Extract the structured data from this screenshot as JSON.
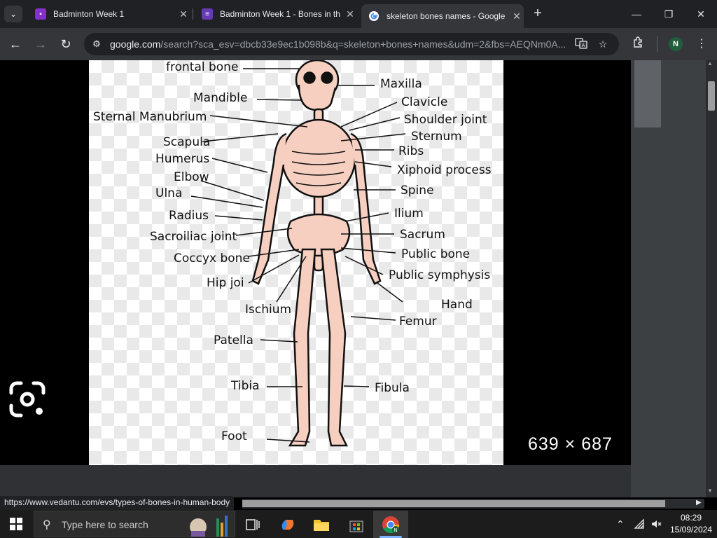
{
  "browser": {
    "tab_search_icon": "chevron-down-icon",
    "tabs": [
      {
        "title": "Badminton Week 1",
        "favicon": "classroom-assignment-icon",
        "favicon_color": "#8430ce"
      },
      {
        "title": "Badminton Week 1 - Bones in th",
        "favicon": "forms-icon",
        "favicon_color": "#673ab7"
      },
      {
        "title": "skeleton bones names - Google",
        "favicon": "google-icon",
        "favicon_color": "#ffffff"
      }
    ],
    "window_controls": {
      "minimize": "—",
      "maximize": "❐",
      "close": "✕"
    },
    "url_host": "google.com",
    "url_path": "/search?sca_esv=dbcb33e9ec1b098b&q=skeleton+bones+names&udm=2&fbs=AEQNm0A...",
    "profile_initial": "N",
    "status_url": "https://www.vedantu.com/evs/types-of-bones-in-human-body"
  },
  "viewer": {
    "image_dimensions": "639 × 687",
    "labels_left": [
      "frontal bone",
      "Mandible",
      "Sternal Manubrium",
      "Scapula",
      "Humerus",
      "Elbow",
      "Ulna",
      "Radius",
      "Sacroiliac joint",
      "Coccyx bone",
      "Hip joi",
      "Ischium",
      "Patella",
      "Tibia",
      "Foot"
    ],
    "labels_right": [
      "Maxilla",
      "Clavicle",
      "Shoulder joint",
      "Sternum",
      "Ribs",
      "Xiphoid process",
      "Spine",
      "Ilium",
      "Sacrum",
      "Public bone",
      "Public symphysis",
      "Hand",
      "Femur",
      "Fibula"
    ]
  },
  "taskbar": {
    "search_placeholder": "Type here to search",
    "time": "08:29",
    "date": "15/09/2024"
  },
  "colors": {
    "accent_profile": "#1e5e3a",
    "bone": "#f6cfc0"
  }
}
